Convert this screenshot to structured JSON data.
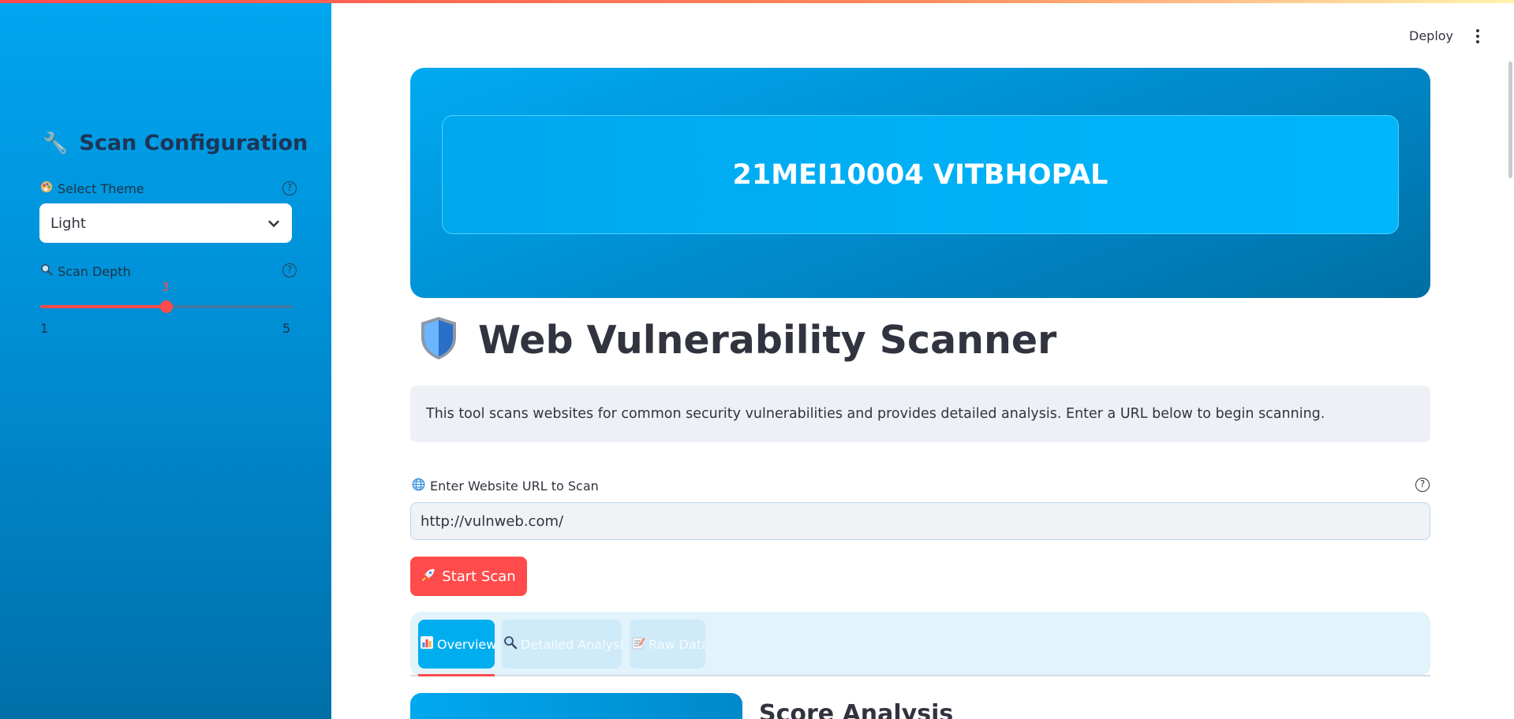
{
  "sidebar": {
    "title": "Scan Configuration",
    "title_icon": "wrench-icon",
    "theme": {
      "label": "Select Theme",
      "label_icon": "palette-icon",
      "selected": "Light"
    },
    "scan_depth": {
      "label": "Scan Depth",
      "label_icon": "magnifier-icon",
      "value": "3",
      "min": "1",
      "max": "5",
      "level_fraction": 0.5
    }
  },
  "header": {
    "deploy_label": "Deploy",
    "menu_icon": "kebab-menu-icon"
  },
  "hero": {
    "banner_text": "21MEI10004 VITBHOPAL"
  },
  "main": {
    "title": "Web Vulnerability Scanner",
    "title_icon": "shield-icon",
    "info_text": "This tool scans websites for common security vulnerabilities and provides detailed analysis. Enter a URL below to begin scanning.",
    "url_field": {
      "label": "Enter Website URL to Scan",
      "label_icon": "globe-icon",
      "value": "http://vulnweb.com/"
    },
    "start_button": {
      "label": "Start Scan",
      "icon": "rocket-icon"
    },
    "tabs": [
      {
        "label": "Overview",
        "icon": "bar-chart-icon",
        "active": true
      },
      {
        "label": "Detailed Analysis",
        "icon": "magnifier-icon",
        "active": false
      },
      {
        "label": "Raw Data",
        "icon": "memo-icon",
        "active": false
      }
    ],
    "section_heading": "Score Analysis"
  },
  "colors": {
    "accent": "#ff4b4b",
    "sidebar_top": "#00a6f0",
    "sidebar_bottom": "#006fa8",
    "tab_active": "#00aef0",
    "info_bg": "#edf1f6"
  }
}
